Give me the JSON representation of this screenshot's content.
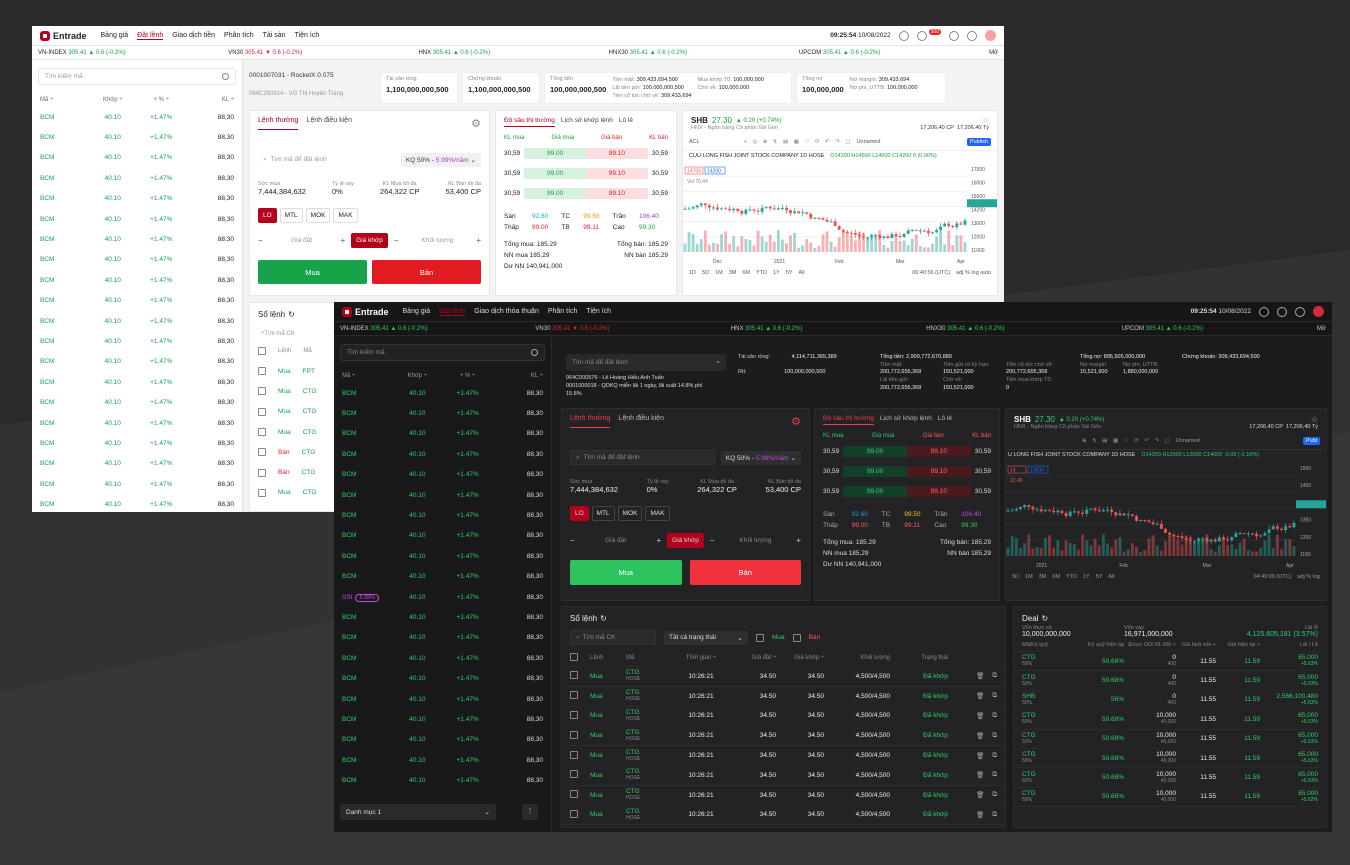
{
  "light": {
    "logo": "Entrade",
    "nav": [
      "Bảng giá",
      "Đặt lệnh",
      "Giao dịch tiền",
      "Phân tích",
      "Tài sản",
      "Tiện ích"
    ],
    "time": "09:25:54",
    "date": "10/08/2022",
    "badge": "200",
    "indices": [
      {
        "name": "VN-INDEX",
        "val": "305.41",
        "chg": "▲ 0.6 (-0.2%)",
        "dir": "up"
      },
      {
        "name": "VN30",
        "val": "305.41",
        "chg": "▼ 0.6 (-0.2%)",
        "dir": "dn"
      },
      {
        "name": "HNX",
        "val": "305.41",
        "chg": "▲ 0.6 (-0.2%)",
        "dir": "up"
      },
      {
        "name": "HNX30",
        "val": "305.41",
        "chg": "▲ 0.6 (-0.2%)",
        "dir": "up"
      },
      {
        "name": "UPCOM",
        "val": "305.41",
        "chg": "▲ 0.6 (-0.2%)",
        "dir": "up"
      }
    ],
    "more": "Mở",
    "search_ph": "Tìm kiếm mã",
    "watch_head": [
      "Mã ÷",
      "Khớp ÷",
      "+ % ÷",
      "KL ÷"
    ],
    "watch_row": [
      "BCM",
      "40.10",
      "+1.47%",
      "88,30"
    ],
    "account": {
      "id": "0001007031 - RocketX 0.075",
      "sub": "064C280814 - VG Thị Huyền Trang"
    },
    "pills": [
      {
        "l": "Tài sản ròng",
        "v": "1,100,000,000,500"
      },
      {
        "l": "Chứng khoán",
        "v": "1,100,000,000,500"
      }
    ],
    "money": {
      "tong_tien_l": "Tổng tiền",
      "tong_tien": "100,000,000,500",
      "tien_mat_l": "Tiền mặt:",
      "tien_mat": "309,433,694,500",
      "lai_l": "Lãi tiền gửi:",
      "lai": "100,000,000,500",
      "coTuc_l": "Tiền cổ tức chờ về:",
      "coTuc": "309,433,694",
      "muaT0_l": "Mua khớp T0:",
      "muaT0": "100,000,000",
      "chove_l": "Chờ về:",
      "chove": "100,000,000",
      "tongno_l": "Tổng nợ",
      "tongno": "100,000,000",
      "margin_l": "Nợ margin:",
      "margin": "309,433,694",
      "uttb_l": "Nợ phí, UTTB:",
      "uttb": "100,000,000"
    },
    "order": {
      "tab1": "Lệnh thường",
      "tab2": "Lệnh điều kiện",
      "code_ph": "Tìm mã để đặt lệnh",
      "kq": "KQ 50% - ",
      "kq_rate": "5.99%/năm",
      "suc_mua_l": "Sức mua",
      "suc_mua": "7,444,384,632",
      "tyle_l": "Tỷ lệ vay",
      "tyle": "0%",
      "klmua_l": "KL Mua tối đa",
      "klmua": "264,322 CP",
      "klban_l": "KL Bán tối đa",
      "klban": "53,400 CP",
      "types": [
        "LO",
        "MTL",
        "MOK",
        "MAK"
      ],
      "price_ph": "Giá đặt",
      "match": "Giá khớp",
      "vol_ph": "Khối lượng",
      "buy": "Mua",
      "sell": "Bán"
    },
    "book": {
      "tabs": [
        "Độ sâu thị trường",
        "Lịch sử khớp lệnh",
        "Lô lẻ"
      ],
      "head": [
        "KL mua",
        "Giá mua",
        "Giá bán",
        "KL bán"
      ],
      "rows": [
        [
          "30,59",
          "99.00",
          "99.10",
          "30,59"
        ],
        [
          "30,59",
          "99.00",
          "99.10",
          "30,59"
        ],
        [
          "30,59",
          "99.00",
          "99.10",
          "30,59"
        ]
      ],
      "san_l": "Sàn",
      "san": "92.60",
      "tc_l": "TC",
      "tc": "99.50",
      "tran_l": "Trần",
      "tran": "106.40",
      "thap_l": "Thấp",
      "thap": "99.00",
      "tb_l": "TB",
      "tb": "99.11",
      "cao_l": "Cao",
      "cao": "99.30",
      "tongmua": "Tổng mua: 185.29",
      "tongban": "Tổng bán: 185.29",
      "nnmua": "NN mua 185,29",
      "nnban": "NN bán 185,29",
      "dunn": "Dư NN 140,941,000"
    },
    "chart": {
      "sym": "SHB",
      "price": "27.30",
      "chg": "▲ 0.20 (+0.74%)",
      "desc": "HNX - Ngân hàng Cổ phần Sài Gòn",
      "cp": "17,206,40",
      "cp_u": "CP",
      "ty": "17,206,40",
      "ty_u": "Tỷ",
      "title": "CUU LONG FISH JOINT STOCK COMPANY  1D  HOSE",
      "ohlc": "O14200 H14500 L14000 C14200 0 (0.00%)",
      "sym_box": "ACL",
      "unnamed": "Unnamed",
      "publish": "Publish",
      "box1": "14700",
      "box2": "14200",
      "vol": "Vol  70.44",
      "yticks": [
        "17000",
        "16000",
        "15000",
        "14200",
        "13000",
        "12000",
        "11000"
      ],
      "xticks": [
        "Dec",
        "2021",
        "Feb",
        "Mar",
        "Apr"
      ],
      "ranges": [
        "1D",
        "5D",
        "1M",
        "3M",
        "6M",
        "YTD",
        "1Y",
        "5Y",
        "All"
      ],
      "clock": "06:40:56 (UTC)",
      "opts": "adj  %  log  auto"
    },
    "orders": {
      "title": "Sổ lệnh",
      "search_ph": "Tìm mã CK",
      "head": [
        "Lệnh",
        "Mã"
      ],
      "rows": [
        [
          "Mua",
          "FPT"
        ],
        [
          "Mua",
          "CTG"
        ],
        [
          "Mua",
          "CTG"
        ],
        [
          "Mua",
          "CTG"
        ],
        [
          "Bán",
          "CTG"
        ],
        [
          "Bán",
          "CTG"
        ],
        [
          "Mua",
          "CTG"
        ]
      ]
    }
  },
  "dark": {
    "time": "09:25:54",
    "date": "10/08/2022",
    "nav": [
      "Bảng giá",
      "Đặt lệnh",
      "Giao dịch thỏa thuận",
      "Phân tích",
      "Tiện ích"
    ],
    "indices": [
      {
        "name": "VN-INDEX",
        "val": "305.41",
        "chg": "▲ 0.6 (-0.2%)",
        "dir": "up"
      },
      {
        "name": "VN30",
        "val": "305.41",
        "chg": "▼ 0.6 (-0.2%)",
        "dir": "dn"
      },
      {
        "name": "HNX",
        "val": "305.41",
        "chg": "▲ 0.6 (-0.2%)",
        "dir": "up"
      },
      {
        "name": "HNX30",
        "val": "305.41",
        "chg": "▲ 0.6 (-0.2%)",
        "dir": "up"
      },
      {
        "name": "UPCOM",
        "val": "305.41",
        "chg": "▲ 0.6 (-0.2%)",
        "dir": "up"
      }
    ],
    "more": "Mở",
    "search_ph": "Tìm kiếm mã",
    "watch_head": [
      "Mã ÷",
      "Khớp ÷",
      "+ % ÷",
      "KL ÷"
    ],
    "watch_row": [
      "BCM",
      "40.10",
      "+1.47%",
      "88,30"
    ],
    "ssi": "SSI",
    "ssi_rate": "5.99%",
    "category": "Danh mục 1",
    "code_ph": "Tìm mã để đặt lệnh",
    "acct1": "064C000576 - Lê Hoàng Hiếu Anh Tuấn",
    "acct2": "0001000018 - QDKQ miễn lãi 1 ngày, lãi suất 14.8% phí 15.8%",
    "summary": {
      "tsr_l": "Tài sản ròng:",
      "tsr": "4,114,711,365,389",
      "rtt_l": "Rtt:",
      "rtt": "100,000,000,500",
      "tongtien": "Tổng tiền: 2,909,772,670,889",
      "tm_l": "Tiền mặt:",
      "tm": "200,772,655,368",
      "tg_l": "Tiền gửi có kỳ hạn:",
      "tg": "150,521,000",
      "ct_l": "Tiền cổ tức chờ về:",
      "ct": "200,772,655,368",
      "lai_l": "Lãi tiền gửi:",
      "lai": "200,772,655,368",
      "cv_l": "Chờ về:",
      "cv": "150,521,000",
      "t0_l": "Tiền mua khớp T0:",
      "t0": "0",
      "tongno": "Tổng nợ: 895,505,000,000",
      "nm_l": "Nợ margin:",
      "nm": "15,521,900",
      "np_l": "Nợ phí, UTTB:",
      "np": "1,880,000,000",
      "ck": "Chứng khoán: 309,433,694,500"
    },
    "order": {
      "tab1": "Lệnh thường",
      "tab2": "Lệnh điều kiện",
      "code_ph": "Tìm mã để đặt lệnh",
      "kq": "KQ 50% - ",
      "kq_rate": "5.99%/năm",
      "suc_mua_l": "Sức mua",
      "suc_mua": "7,444,384,632",
      "tyle_l": "Tỷ lệ vay",
      "tyle": "0%",
      "klmua_l": "KL Mua tối đa",
      "klmua": "264,322 CP",
      "klban_l": "KL Bán tối đa",
      "klban": "53,400 CP",
      "types": [
        "LO",
        "MTL",
        "MOK",
        "MAK"
      ],
      "price_ph": "Giá đặt",
      "match": "Giá khớp",
      "vol_ph": "Khối lượng",
      "buy": "Mua",
      "sell": "Bán"
    },
    "book": {
      "tabs": [
        "Độ sâu thị trường",
        "Lịch sử khớp lệnh",
        "Lô lẻ"
      ],
      "head": [
        "KL mua",
        "Giá mua",
        "Giá bán",
        "KL bán"
      ],
      "rows": [
        [
          "30,59",
          "99.00",
          "99.10",
          "30,59"
        ],
        [
          "30,59",
          "99.00",
          "99.10",
          "30,59"
        ],
        [
          "30,59",
          "99.00",
          "99.10",
          "30,59"
        ]
      ],
      "san_l": "Sàn",
      "san": "92.60",
      "tc_l": "TC",
      "tc": "99.50",
      "tran_l": "Trần",
      "tran": "106.40",
      "thap_l": "Thấp",
      "thap": "99.00",
      "tb_l": "TB",
      "tb": "99.11",
      "cao_l": "Cao",
      "cao": "99.30",
      "tongmua": "Tổng mua: 185.29",
      "tongban": "Tổng bán: 185.29",
      "nnmua": "NN mua 185,29",
      "nnban": "NN bán 185,29",
      "dunn": "Dư NN 140,941,000"
    },
    "chart": {
      "sym": "SHB",
      "price": "27.30",
      "chg": "▲ 0.20 (+0.74%)",
      "desc": "HNX - Ngân hàng Cổ phần Sài Gòn",
      "cp": "17,206,40",
      "cp_u": "CP",
      "ty": "17,206,40",
      "ty_u": "Tỷ",
      "title": "U LONG FISH JOINT STOCK COMPANY  1D  HOSE",
      "ohlc": "O14200 H12000 L12000 C14000 -0.00 (-2.16%)",
      "unnamed": "Unnamed",
      "publish": "Publ",
      "box1": "14",
      "box2": "13800",
      "vol": "22.46",
      "yticks": [
        "1500",
        "1450",
        "1400",
        "1350",
        "1200",
        "1150"
      ],
      "xticks": [
        "2021",
        "Feb",
        "Mar",
        "Apr"
      ],
      "ranges": [
        "5D",
        "1M",
        "3M",
        "6M",
        "YTD",
        "1Y",
        "5Y",
        "All"
      ],
      "clock": "04:49:09 (UTC)",
      "opts": "adj  %  log"
    },
    "orders": {
      "title": "Sổ lệnh",
      "search_ph": "Tìm mã CK",
      "status": "Tất cả trạng thái",
      "f_buy": "Mua",
      "f_sell": "Bán",
      "head": [
        "Lệnh",
        "Mã",
        "Thời gian ÷",
        "Giá đặt ÷",
        "Giá khớp ÷",
        "Khối lượng",
        "Trạng thái"
      ],
      "rows": [
        [
          "Mua",
          "CTG",
          "HOSE",
          "10:26:21",
          "34.50",
          "34.50",
          "4,500/4,500",
          "Đã khớp"
        ],
        [
          "Mua",
          "CTG",
          "HOSE",
          "10:26:21",
          "34.50",
          "34.50",
          "4,500/4,500",
          "Đã khớp"
        ],
        [
          "Mua",
          "CTG",
          "HOSE",
          "10:26:21",
          "34.50",
          "34.50",
          "4,500/4,500",
          "Đã khớp"
        ],
        [
          "Mua",
          "CTG",
          "HOSE",
          "10:26:21",
          "34.50",
          "34.50",
          "4,500/4,500",
          "Đã khớp"
        ],
        [
          "Mua",
          "CTG",
          "HOSE",
          "10:26:21",
          "34.50",
          "34.50",
          "4,500/4,500",
          "Đã khớp"
        ],
        [
          "Mua",
          "CTG",
          "HOSE",
          "10:26:21",
          "34.50",
          "34.50",
          "4,500/4,500",
          "Đã khớp"
        ],
        [
          "Mua",
          "CTG",
          "HOSE",
          "10:26:21",
          "34.50",
          "34.50",
          "4,500/4,500",
          "Đã khớp"
        ],
        [
          "Mua",
          "CTG",
          "HOSE",
          "10:26:21",
          "34.50",
          "34.50",
          "4,500/4,500",
          "Đã khớp"
        ]
      ]
    },
    "deal": {
      "title": "Deal",
      "von_l": "Vốn thực có",
      "von": "10,000,000,000",
      "vay_l": "Vốn vay",
      "vay": "16,971,000,000",
      "lai_l": "Lãi lỗ",
      "lai": "4,125,605,181 (3.57%)",
      "head": [
        "Mã/Ký quỹ",
        "Ký quỹ hiện tại",
        "Được GD/ KL Mở ÷",
        "Giá hoà vốn ÷",
        "Giá hiện tại ÷",
        "Lãi / Lỗ"
      ],
      "rows": [
        [
          "CTG",
          "50%",
          "50.68%",
          "0",
          "400",
          "11.55",
          "11.59",
          "65,000",
          "+5.63%"
        ],
        [
          "CTG",
          "50%",
          "50.68%",
          "0",
          "400",
          "11.55",
          "11.59",
          "65,000",
          "+5.63%"
        ],
        [
          "SHB",
          "50%",
          "56%",
          "0",
          "400",
          "11.55",
          "11.59",
          "2,566,100,480",
          "+5.63%"
        ],
        [
          "CTG",
          "50%",
          "50.68%",
          "10,000",
          "40,000",
          "11.55",
          "11.59",
          "65,000",
          "+5.63%"
        ],
        [
          "CTG",
          "50%",
          "50.68%",
          "10,000",
          "40,000",
          "11.55",
          "11.59",
          "65,000",
          "+5.63%"
        ],
        [
          "CTG",
          "50%",
          "50.68%",
          "10,000",
          "40,000",
          "11.55",
          "11.59",
          "65,000",
          "+5.63%"
        ],
        [
          "CTG",
          "50%",
          "50.68%",
          "10,000",
          "40,000",
          "11.55",
          "11.59",
          "65,000",
          "+5.63%"
        ],
        [
          "CTG",
          "50%",
          "50.68%",
          "10,000",
          "40,000",
          "11.55",
          "11.59",
          "65,000",
          "+5.62%"
        ]
      ]
    }
  }
}
